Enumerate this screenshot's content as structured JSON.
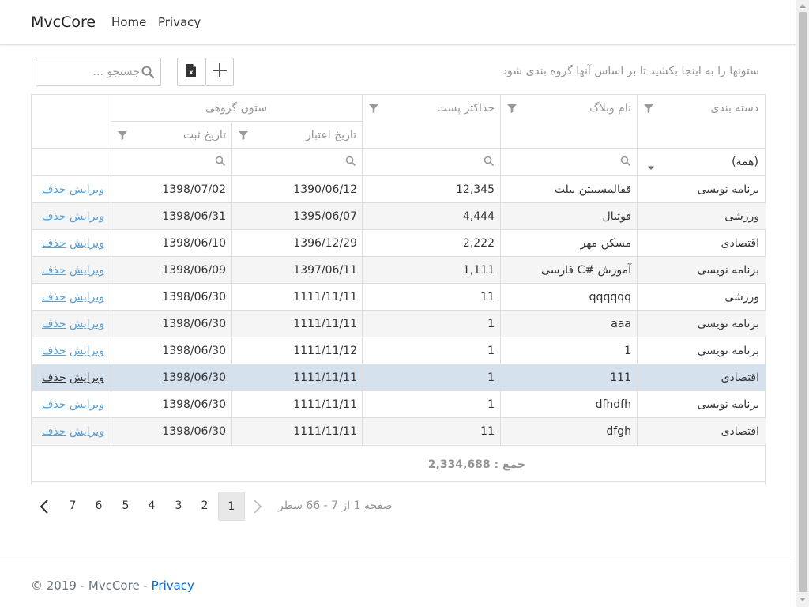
{
  "navbar": {
    "brand": "MvcCore",
    "links": [
      "Home",
      "Privacy"
    ]
  },
  "toolbar": {
    "search_placeholder": "جستجو ...",
    "group_panel_text": "ستونها را به اینجا بکشید تا بر اساس آنها گروه بندی شود"
  },
  "grid": {
    "headers": {
      "category": "دسته بندی",
      "blog_name": "نام وبلاگ",
      "max_post": "حداکثر پست",
      "group_column": "ستون گروهی",
      "validity_date": "تاریخ اعتبار",
      "register_date": "تاریخ ثبت"
    },
    "category_filter_value": "(همه)",
    "rows": [
      {
        "category": "برنامه نویسی",
        "blog": "ققالمسیبتن بیلت",
        "max": "12,345",
        "valid": "1390/06/12",
        "reg": "1398/07/02",
        "del": "حذف",
        "edit": "ویرایش"
      },
      {
        "category": "ورزشی",
        "blog": "فوتبال",
        "max": "4,444",
        "valid": "1395/06/07",
        "reg": "1398/06/31",
        "del": "حذف",
        "edit": "ویرایش"
      },
      {
        "category": "اقتصادی",
        "blog": "مسکن مهر",
        "max": "2,222",
        "valid": "1396/12/29",
        "reg": "1398/06/10",
        "del": "حذف",
        "edit": "ویرایش"
      },
      {
        "category": "برنامه نویسی",
        "blog": "آموزش #C فارسی",
        "max": "1,111",
        "valid": "1397/06/11",
        "reg": "1398/06/09",
        "del": "حذف",
        "edit": "ویرایش"
      },
      {
        "category": "ورزشی",
        "blog": "qqqqqq",
        "max": "11",
        "valid": "1111/11/11",
        "reg": "1398/06/30",
        "del": "حذف",
        "edit": "ویرایش"
      },
      {
        "category": "برنامه نویسی",
        "blog": "aaa",
        "max": "1",
        "valid": "1111/11/11",
        "reg": "1398/06/30",
        "del": "حذف",
        "edit": "ویرایش"
      },
      {
        "category": "برنامه نویسی",
        "blog": "1",
        "max": "1",
        "valid": "1111/11/12",
        "reg": "1398/06/30",
        "del": "حذف",
        "edit": "ویرایش"
      },
      {
        "category": "اقتصادی",
        "blog": "111",
        "max": "1",
        "valid": "1111/11/11",
        "reg": "1398/06/30",
        "del": "حذف",
        "edit": "ویرایش"
      },
      {
        "category": "برنامه نویسی",
        "blog": "dfhdfh",
        "max": "1",
        "valid": "1111/11/11",
        "reg": "1398/06/30",
        "del": "حذف",
        "edit": "ویرایش"
      },
      {
        "category": "اقتصادی",
        "blog": "dfgh",
        "max": "11",
        "valid": "1111/11/11",
        "reg": "1398/06/30",
        "del": "حذف",
        "edit": "ویرایش"
      }
    ],
    "selected_row_index": 7,
    "total_label": "جمع : 2,334,688"
  },
  "pager": {
    "info": "صفحه 1 از 7 - 66 سطر",
    "pages": [
      "1",
      "2",
      "3",
      "4",
      "5",
      "6",
      "7"
    ],
    "active_page": "1"
  },
  "footer": {
    "text": "© 2019 - MvcCore - ",
    "link": "Privacy"
  }
}
